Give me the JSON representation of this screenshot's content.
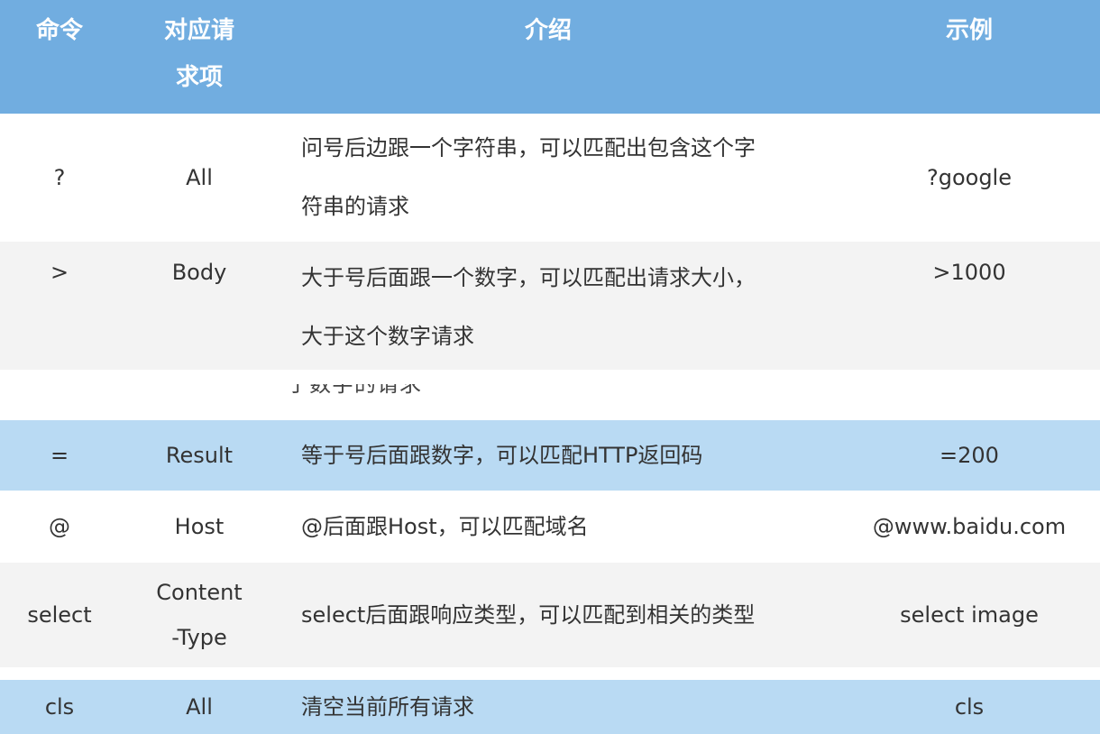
{
  "header": {
    "col1": "命令",
    "col2_line1": "对应请",
    "col2_line2": "求项",
    "col3": "介绍",
    "col4": "示例"
  },
  "rows": [
    {
      "command": "?",
      "item": "All",
      "desc_line1": "问号后边跟一个字符串，可以匹配出包含这个字",
      "desc_line2": "符串的请求",
      "example": "?google"
    },
    {
      "command": ">",
      "item": "Body",
      "desc_line1": "大于号后面跟一个数字，可以匹配出请求大小，",
      "desc_line2": "大于这个数字请求",
      "example": ">1000"
    },
    {
      "command": "=",
      "item": "Result",
      "desc": "等于号后面跟数字，可以匹配HTTP返回码",
      "example": "=200"
    },
    {
      "command": "@",
      "item": "Host",
      "desc": "@后面跟Host，可以匹配域名",
      "example": "@www.baidu.com"
    },
    {
      "command": "select",
      "item_line1": "Content",
      "item_line2": "-Type",
      "desc": "select后面跟响应类型，可以匹配到相关的类型",
      "example": "select image"
    },
    {
      "command": "cls",
      "item": "All",
      "desc": "清空当前所有请求",
      "example": "cls"
    }
  ],
  "clipped_fragment": "于数字的请求"
}
